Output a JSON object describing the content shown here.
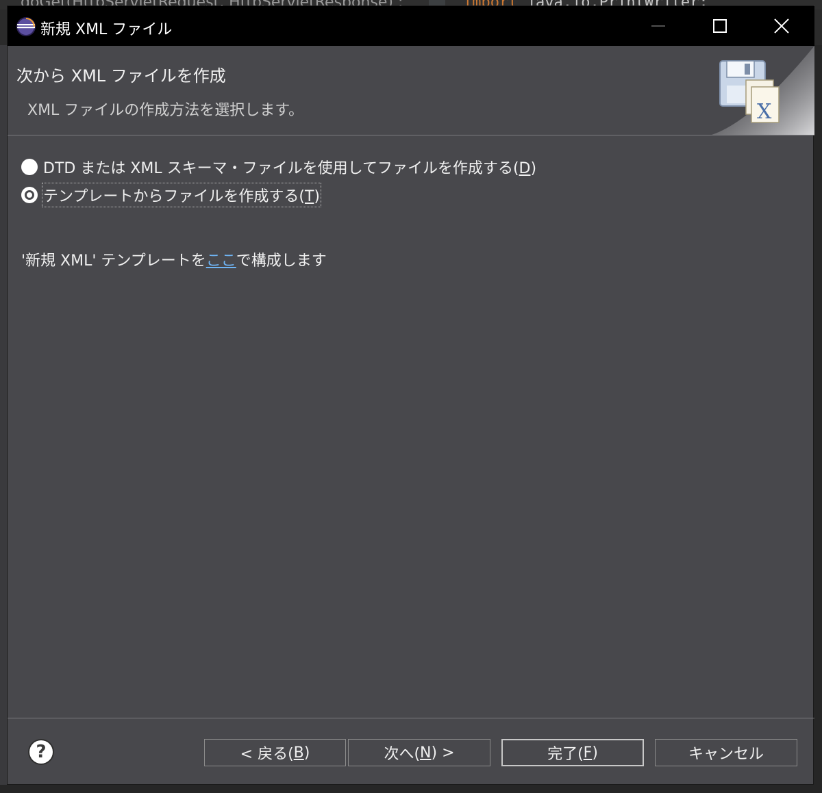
{
  "background": {
    "top_left_text": "doGet(HttpServletRequest, HttpServletResponse) :",
    "top_right_keyword": "import",
    "top_right_text": " java.io.PrintWriter;"
  },
  "window": {
    "title": "新規 XML ファイル"
  },
  "header": {
    "title": "次から XML ファイルを作成",
    "description": "XML ファイルの作成方法を選択します。"
  },
  "options": [
    {
      "label": "DTD または XML スキーマ・ファイルを使用してファイルを作成する(",
      "mnemonic": "D",
      "suffix": ")",
      "selected": false
    },
    {
      "label": "テンプレートからファイルを作成する(",
      "mnemonic": "T",
      "suffix": ")",
      "selected": true
    }
  ],
  "template_link": {
    "prefix": "'新規 XML' テンプレートを",
    "link": "ここ",
    "suffix": "で構成します"
  },
  "buttons": {
    "back_prefix": "< 戻る(",
    "back_mnemonic": "B",
    "back_suffix": ")",
    "next_prefix": "次へ(",
    "next_mnemonic": "N",
    "next_suffix": ") >",
    "finish_prefix": "完了(",
    "finish_mnemonic": "F",
    "finish_suffix": ")",
    "cancel": "キャンセル"
  },
  "colors": {
    "dialog_bg": "#48484c",
    "titlebar_bg": "#000000",
    "link": "#6fb5f5"
  }
}
